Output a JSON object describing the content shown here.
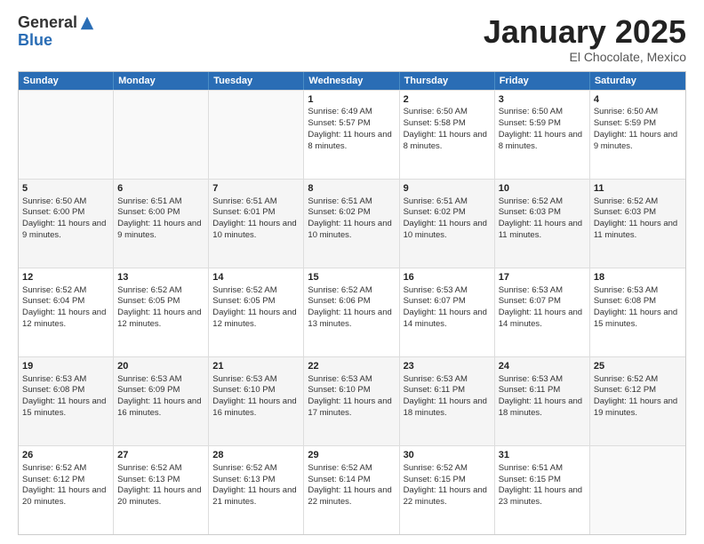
{
  "header": {
    "logo_general": "General",
    "logo_blue": "Blue",
    "month_year": "January 2025",
    "location": "El Chocolate, Mexico"
  },
  "days_of_week": [
    "Sunday",
    "Monday",
    "Tuesday",
    "Wednesday",
    "Thursday",
    "Friday",
    "Saturday"
  ],
  "weeks": [
    [
      {
        "day": "",
        "sunrise": "",
        "sunset": "",
        "daylight": ""
      },
      {
        "day": "",
        "sunrise": "",
        "sunset": "",
        "daylight": ""
      },
      {
        "day": "",
        "sunrise": "",
        "sunset": "",
        "daylight": ""
      },
      {
        "day": "1",
        "sunrise": "Sunrise: 6:49 AM",
        "sunset": "Sunset: 5:57 PM",
        "daylight": "Daylight: 11 hours and 8 minutes."
      },
      {
        "day": "2",
        "sunrise": "Sunrise: 6:50 AM",
        "sunset": "Sunset: 5:58 PM",
        "daylight": "Daylight: 11 hours and 8 minutes."
      },
      {
        "day": "3",
        "sunrise": "Sunrise: 6:50 AM",
        "sunset": "Sunset: 5:59 PM",
        "daylight": "Daylight: 11 hours and 8 minutes."
      },
      {
        "day": "4",
        "sunrise": "Sunrise: 6:50 AM",
        "sunset": "Sunset: 5:59 PM",
        "daylight": "Daylight: 11 hours and 9 minutes."
      }
    ],
    [
      {
        "day": "5",
        "sunrise": "Sunrise: 6:50 AM",
        "sunset": "Sunset: 6:00 PM",
        "daylight": "Daylight: 11 hours and 9 minutes."
      },
      {
        "day": "6",
        "sunrise": "Sunrise: 6:51 AM",
        "sunset": "Sunset: 6:00 PM",
        "daylight": "Daylight: 11 hours and 9 minutes."
      },
      {
        "day": "7",
        "sunrise": "Sunrise: 6:51 AM",
        "sunset": "Sunset: 6:01 PM",
        "daylight": "Daylight: 11 hours and 10 minutes."
      },
      {
        "day": "8",
        "sunrise": "Sunrise: 6:51 AM",
        "sunset": "Sunset: 6:02 PM",
        "daylight": "Daylight: 11 hours and 10 minutes."
      },
      {
        "day": "9",
        "sunrise": "Sunrise: 6:51 AM",
        "sunset": "Sunset: 6:02 PM",
        "daylight": "Daylight: 11 hours and 10 minutes."
      },
      {
        "day": "10",
        "sunrise": "Sunrise: 6:52 AM",
        "sunset": "Sunset: 6:03 PM",
        "daylight": "Daylight: 11 hours and 11 minutes."
      },
      {
        "day": "11",
        "sunrise": "Sunrise: 6:52 AM",
        "sunset": "Sunset: 6:03 PM",
        "daylight": "Daylight: 11 hours and 11 minutes."
      }
    ],
    [
      {
        "day": "12",
        "sunrise": "Sunrise: 6:52 AM",
        "sunset": "Sunset: 6:04 PM",
        "daylight": "Daylight: 11 hours and 12 minutes."
      },
      {
        "day": "13",
        "sunrise": "Sunrise: 6:52 AM",
        "sunset": "Sunset: 6:05 PM",
        "daylight": "Daylight: 11 hours and 12 minutes."
      },
      {
        "day": "14",
        "sunrise": "Sunrise: 6:52 AM",
        "sunset": "Sunset: 6:05 PM",
        "daylight": "Daylight: 11 hours and 12 minutes."
      },
      {
        "day": "15",
        "sunrise": "Sunrise: 6:52 AM",
        "sunset": "Sunset: 6:06 PM",
        "daylight": "Daylight: 11 hours and 13 minutes."
      },
      {
        "day": "16",
        "sunrise": "Sunrise: 6:53 AM",
        "sunset": "Sunset: 6:07 PM",
        "daylight": "Daylight: 11 hours and 14 minutes."
      },
      {
        "day": "17",
        "sunrise": "Sunrise: 6:53 AM",
        "sunset": "Sunset: 6:07 PM",
        "daylight": "Daylight: 11 hours and 14 minutes."
      },
      {
        "day": "18",
        "sunrise": "Sunrise: 6:53 AM",
        "sunset": "Sunset: 6:08 PM",
        "daylight": "Daylight: 11 hours and 15 minutes."
      }
    ],
    [
      {
        "day": "19",
        "sunrise": "Sunrise: 6:53 AM",
        "sunset": "Sunset: 6:08 PM",
        "daylight": "Daylight: 11 hours and 15 minutes."
      },
      {
        "day": "20",
        "sunrise": "Sunrise: 6:53 AM",
        "sunset": "Sunset: 6:09 PM",
        "daylight": "Daylight: 11 hours and 16 minutes."
      },
      {
        "day": "21",
        "sunrise": "Sunrise: 6:53 AM",
        "sunset": "Sunset: 6:10 PM",
        "daylight": "Daylight: 11 hours and 16 minutes."
      },
      {
        "day": "22",
        "sunrise": "Sunrise: 6:53 AM",
        "sunset": "Sunset: 6:10 PM",
        "daylight": "Daylight: 11 hours and 17 minutes."
      },
      {
        "day": "23",
        "sunrise": "Sunrise: 6:53 AM",
        "sunset": "Sunset: 6:11 PM",
        "daylight": "Daylight: 11 hours and 18 minutes."
      },
      {
        "day": "24",
        "sunrise": "Sunrise: 6:53 AM",
        "sunset": "Sunset: 6:11 PM",
        "daylight": "Daylight: 11 hours and 18 minutes."
      },
      {
        "day": "25",
        "sunrise": "Sunrise: 6:52 AM",
        "sunset": "Sunset: 6:12 PM",
        "daylight": "Daylight: 11 hours and 19 minutes."
      }
    ],
    [
      {
        "day": "26",
        "sunrise": "Sunrise: 6:52 AM",
        "sunset": "Sunset: 6:12 PM",
        "daylight": "Daylight: 11 hours and 20 minutes."
      },
      {
        "day": "27",
        "sunrise": "Sunrise: 6:52 AM",
        "sunset": "Sunset: 6:13 PM",
        "daylight": "Daylight: 11 hours and 20 minutes."
      },
      {
        "day": "28",
        "sunrise": "Sunrise: 6:52 AM",
        "sunset": "Sunset: 6:13 PM",
        "daylight": "Daylight: 11 hours and 21 minutes."
      },
      {
        "day": "29",
        "sunrise": "Sunrise: 6:52 AM",
        "sunset": "Sunset: 6:14 PM",
        "daylight": "Daylight: 11 hours and 22 minutes."
      },
      {
        "day": "30",
        "sunrise": "Sunrise: 6:52 AM",
        "sunset": "Sunset: 6:15 PM",
        "daylight": "Daylight: 11 hours and 22 minutes."
      },
      {
        "day": "31",
        "sunrise": "Sunrise: 6:51 AM",
        "sunset": "Sunset: 6:15 PM",
        "daylight": "Daylight: 11 hours and 23 minutes."
      },
      {
        "day": "",
        "sunrise": "",
        "sunset": "",
        "daylight": ""
      }
    ]
  ]
}
